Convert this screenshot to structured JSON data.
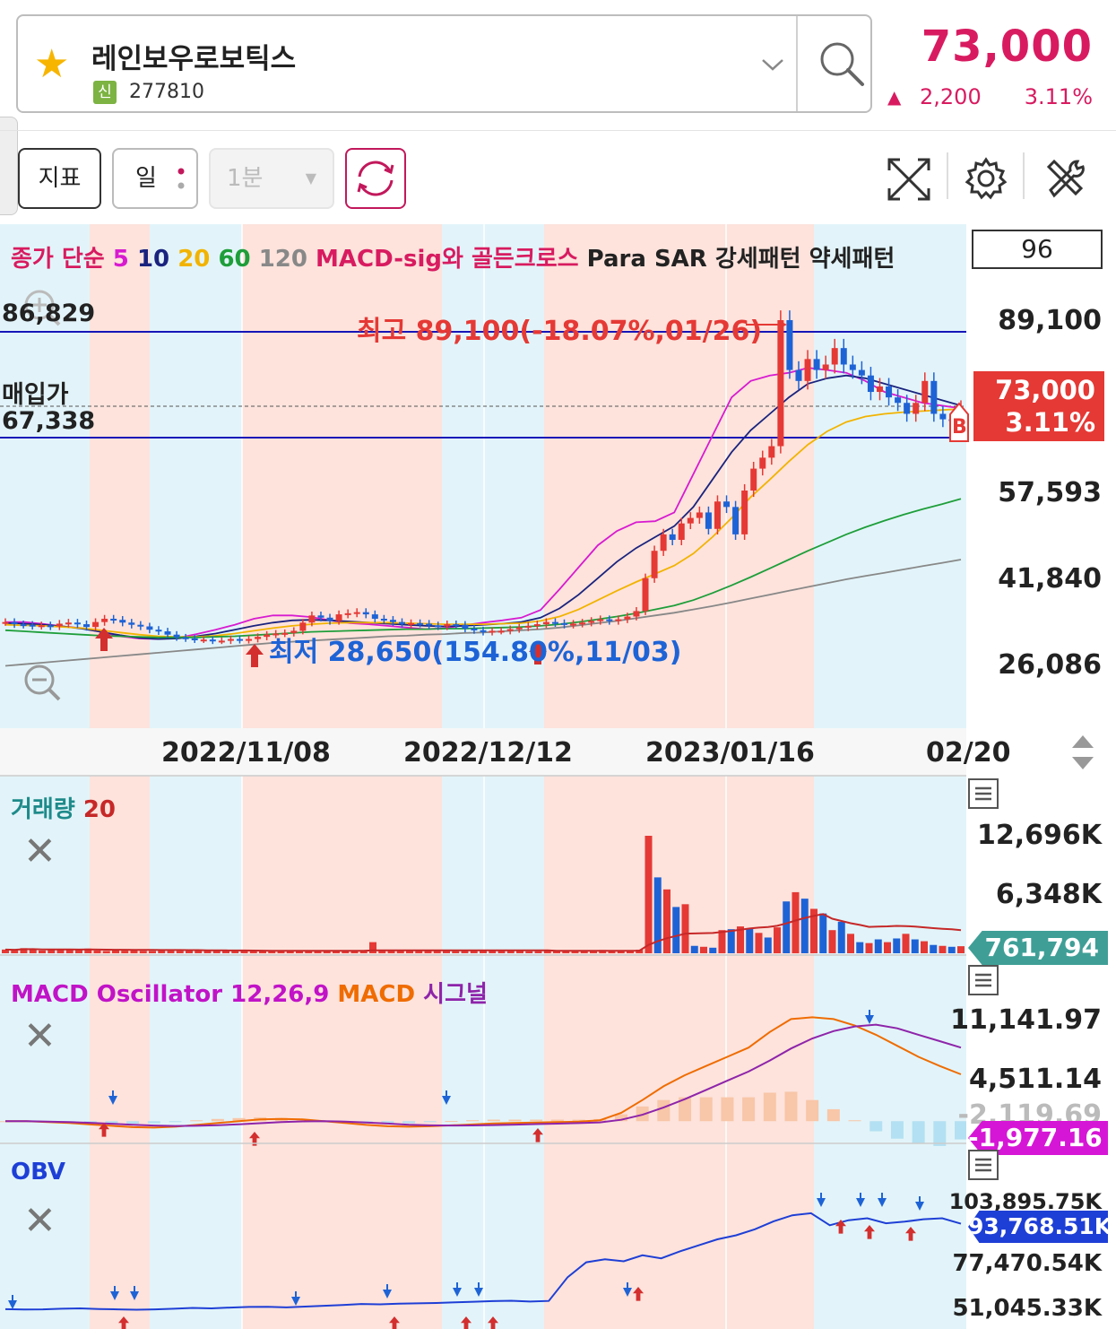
{
  "header": {
    "stock_name": "레인보우로보틱스",
    "badge": "신",
    "stock_code": "277810",
    "price": "73,000",
    "change_arrow": "▲",
    "change_amount": "2,200",
    "change_percent": "3.11%"
  },
  "toolbar": {
    "indicator_label": "지표",
    "period_label": "일",
    "minute_label": "1분",
    "minute_caret": "▼"
  },
  "legend": {
    "close_label": "종가 단순",
    "ma5": "5",
    "ma10": "10",
    "ma20": "20",
    "ma60": "60",
    "ma120": "120",
    "macd_cross": "MACD-sig와 골든크로스",
    "para_sar": "Para SAR",
    "bull_pattern": "강세패턴",
    "bear_pattern": "약세패턴",
    "count": "96"
  },
  "price_pane": {
    "left_labels": {
      "level_top": "86,829",
      "buy_label": "매입가",
      "buy_price": "67,338"
    },
    "max_annotation": "최고 89,100(-18.07%,01/26)",
    "min_annotation": "최저 28,650(154.80%,11/03)",
    "current_tag": {
      "price": "73,000",
      "percent": "3.11%"
    },
    "signal_marker": "B"
  },
  "volume_pane": {
    "title": "거래량",
    "period": "20",
    "y_labels": [
      "12,696K",
      "6,348K"
    ],
    "current": "761,794"
  },
  "macd_pane": {
    "title": "MACD Oscillator 12,26,9",
    "macd_label": "MACD",
    "signal_label": "시그널",
    "y_labels": [
      "11,141.97",
      "4,511.14",
      "-2,119.69"
    ],
    "current": "-1,977.16"
  },
  "obv_pane": {
    "title": "OBV",
    "y_labels": [
      "103,895.75K",
      "77,470.54K",
      "51,045.33K"
    ],
    "current": "93,768.51K"
  },
  "colors": {
    "up": "#e53935",
    "down": "#1e63d6",
    "ma5": "#d81bd0",
    "ma10": "#1a237e",
    "ma20": "#f2b300",
    "ma60": "#1e9e3a",
    "ma120": "#888888",
    "bull_band": "#fde3dc",
    "bear_band": "#e2f4f9",
    "accent": "#d81b60"
  },
  "chart_data": {
    "type": "candlestick",
    "x_ticks": [
      "2022/11/08",
      "2022/12/12",
      "2023/01/16",
      "02/20"
    ],
    "y_ticks": [
      89100,
      57593,
      41840,
      26086
    ],
    "ylim": [
      20000,
      100000
    ],
    "reference_lines": {
      "high": 86829,
      "buy": 67338,
      "low": 66100
    },
    "max": {
      "value": 89100,
      "date": "01/26"
    },
    "min": {
      "value": 28650,
      "date": "11/03"
    },
    "close": [
      34000,
      33600,
      33500,
      33300,
      33400,
      33200,
      33700,
      33900,
      33600,
      33100,
      34000,
      34600,
      34400,
      33900,
      33500,
      33200,
      32600,
      32300,
      31700,
      31200,
      31000,
      30800,
      30800,
      30600,
      30600,
      30900,
      30700,
      30900,
      31300,
      31700,
      31900,
      32000,
      32400,
      33900,
      35200,
      34800,
      34200,
      35400,
      35600,
      35800,
      35400,
      34600,
      34400,
      34000,
      33600,
      33800,
      33700,
      33400,
      33200,
      33600,
      33500,
      32800,
      32500,
      32200,
      32400,
      32400,
      32700,
      33000,
      33300,
      33600,
      34000,
      33800,
      33500,
      33700,
      33900,
      34200,
      34500,
      34200,
      34500,
      35000,
      36000,
      42000,
      47000,
      50000,
      49000,
      52000,
      53000,
      54000,
      51000,
      56000,
      55000,
      50000,
      58000,
      62000,
      64000,
      66100,
      89100,
      80000,
      78000,
      82000,
      80000,
      81000,
      84000,
      81000,
      80000,
      79000,
      76000,
      77000,
      75000,
      74000,
      72000,
      74000,
      78000,
      72000,
      71000,
      70800,
      73000
    ],
    "ma_series": [
      {
        "name": "5",
        "values": [
          34000,
          34000,
          33650,
          33200,
          32900,
          32200,
          31400,
          31000,
          30900,
          31100,
          31800,
          32600,
          33500,
          34600,
          35200,
          35200,
          34900,
          34300,
          33800,
          33600,
          33300,
          33000,
          32700,
          32900,
          33400,
          33900,
          34300,
          34800,
          36200,
          40000,
          44000,
          48000,
          50600,
          52200,
          52400,
          54000,
          61000,
          68000,
          75000,
          78000,
          79000,
          79500,
          80400,
          80000,
          79500,
          78000,
          76000,
          75000,
          74000,
          73500,
          73000
        ]
      },
      {
        "name": "10",
        "values": [
          33800,
          33700,
          33500,
          33200,
          32800,
          32200,
          31600,
          31100,
          30900,
          31000,
          31400,
          31900,
          32600,
          33300,
          33900,
          34300,
          34400,
          34300,
          34100,
          33900,
          33700,
          33500,
          33300,
          33200,
          33300,
          33500,
          33700,
          34000,
          34800,
          36500,
          39000,
          42000,
          45000,
          47500,
          49500,
          51500,
          55000,
          60000,
          65000,
          69000,
          72000,
          75000,
          77500,
          78500,
          79000,
          78500,
          77500,
          76500,
          75500,
          74500,
          73500
        ]
      },
      {
        "name": "20",
        "values": [
          33500,
          33400,
          33300,
          33100,
          32900,
          32500,
          32100,
          31700,
          31400,
          31300,
          31300,
          31500,
          31900,
          32400,
          32900,
          33300,
          33600,
          33800,
          33900,
          33900,
          33900,
          33800,
          33700,
          33600,
          33600,
          33600,
          33700,
          33800,
          34200,
          35000,
          36300,
          38000,
          39700,
          41300,
          42800,
          44300,
          46500,
          49500,
          53000,
          56800,
          60000,
          63300,
          66400,
          68800,
          70500,
          71500,
          72000,
          72300,
          72500,
          72700,
          72900
        ]
      },
      {
        "name": "60",
        "values": [
          32500,
          32300,
          32100,
          31900,
          31700,
          31500,
          31400,
          31300,
          31200,
          31200,
          31200,
          31300,
          31400,
          31600,
          31800,
          32000,
          32200,
          32300,
          32400,
          32500,
          32600,
          32700,
          32700,
          32800,
          32800,
          32900,
          33000,
          33100,
          33300,
          33600,
          34000,
          34500,
          35000,
          35600,
          36300,
          37000,
          38000,
          39300,
          40700,
          42200,
          43800,
          45400,
          47000,
          48500,
          50000,
          51300,
          52500,
          53600,
          54600,
          55500,
          56500
        ]
      },
      {
        "name": "120",
        "values": [
          26000,
          26300,
          26600,
          26900,
          27200,
          27500,
          27800,
          28100,
          28400,
          28700,
          29000,
          29300,
          29600,
          29900,
          30200,
          30400,
          30600,
          30800,
          31000,
          31200,
          31400,
          31500,
          31700,
          31800,
          32000,
          32100,
          32300,
          32500,
          32700,
          33000,
          33400,
          33800,
          34200,
          34700,
          35200,
          35700,
          36300,
          36900,
          37600,
          38300,
          39000,
          39700,
          40400,
          41100,
          41800,
          42400,
          43000,
          43600,
          44200,
          44800,
          45400
        ]
      }
    ],
    "volume": {
      "y_ticks": [
        12696,
        6348
      ],
      "unit": "K",
      "values": [
        400,
        350,
        550,
        500,
        300,
        350,
        380,
        400,
        350,
        500,
        300,
        250,
        330,
        280,
        300,
        260,
        250,
        300,
        280,
        270,
        260,
        280,
        300,
        250,
        280,
        240,
        250,
        260,
        230,
        250,
        280,
        300,
        250,
        220,
        260,
        240,
        250,
        280,
        290,
        300,
        1200,
        350,
        250,
        300,
        280,
        270,
        260,
        250,
        240,
        230,
        260,
        300,
        280,
        250,
        240,
        260,
        280,
        220,
        230,
        250,
        240,
        260,
        280,
        300,
        320,
        350,
        300,
        280,
        340,
        380,
        12696,
        8200,
        6900,
        5000,
        5300,
        800,
        700,
        600,
        2500,
        2600,
        2900,
        2700,
        2200,
        1700,
        2800,
        5600,
        6600,
        5900,
        4800,
        4300,
        2500,
        3400,
        2100,
        1200,
        1100,
        1500,
        1200,
        1600,
        2100,
        1500,
        1300,
        900,
        800,
        700,
        761.794
      ]
    },
    "macd": {
      "y_ticks": [
        11141.97,
        4511.14,
        -2119.69
      ],
      "current": -1977.16,
      "macd_line": [
        0,
        0,
        -100,
        -200,
        -350,
        -500,
        -650,
        -700,
        -600,
        -400,
        -200,
        0,
        200,
        250,
        200,
        0,
        -200,
        -400,
        -550,
        -600,
        -550,
        -450,
        -350,
        -250,
        -200,
        -150,
        -100,
        -50,
        100,
        900,
        2300,
        3800,
        5000,
        6000,
        7000,
        8000,
        9700,
        11100,
        11300,
        11100,
        10400,
        9400,
        8200,
        7000,
        6000,
        5100
      ],
      "signal_line": [
        0,
        0,
        -50,
        -100,
        -180,
        -280,
        -380,
        -470,
        -520,
        -500,
        -440,
        -340,
        -220,
        -100,
        -20,
        0,
        -40,
        -140,
        -260,
        -380,
        -450,
        -470,
        -460,
        -420,
        -370,
        -320,
        -270,
        -210,
        -130,
        150,
        700,
        1500,
        2400,
        3400,
        4400,
        5400,
        6600,
        7900,
        9000,
        9800,
        10300,
        10500,
        10100,
        9400,
        8700,
        8000
      ],
      "oscillator": [
        0,
        0,
        -50,
        -100,
        -170,
        -220,
        -270,
        -230,
        -80,
        100,
        240,
        340,
        420,
        350,
        220,
        0,
        -160,
        -260,
        -290,
        -220,
        -100,
        20,
        110,
        170,
        170,
        170,
        170,
        160,
        230,
        750,
        1600,
        2300,
        2600,
        2600,
        2600,
        2600,
        3100,
        3200,
        2300,
        1300,
        100,
        -1100,
        -1900,
        -2400,
        -2700,
        -1977.16
      ]
    },
    "obv": {
      "y_ticks": [
        103895.75,
        77470.54,
        51045.33
      ],
      "unit": "K",
      "current": 93768.51,
      "values": [
        51100,
        50900,
        51000,
        51300,
        51500,
        51200,
        51000,
        50800,
        51000,
        51300,
        51700,
        51500,
        51900,
        52200,
        52300,
        52000,
        52400,
        52800,
        53200,
        53700,
        53500,
        53800,
        54000,
        54200,
        54500,
        54800,
        55100,
        55300,
        54900,
        55200,
        67000,
        74500,
        76000,
        75000,
        78000,
        76500,
        80000,
        83000,
        86000,
        88000,
        91000,
        95000,
        98000,
        99000,
        93000,
        95500,
        96500,
        94000,
        94800,
        96000,
        96500,
        93768.51
      ]
    }
  }
}
